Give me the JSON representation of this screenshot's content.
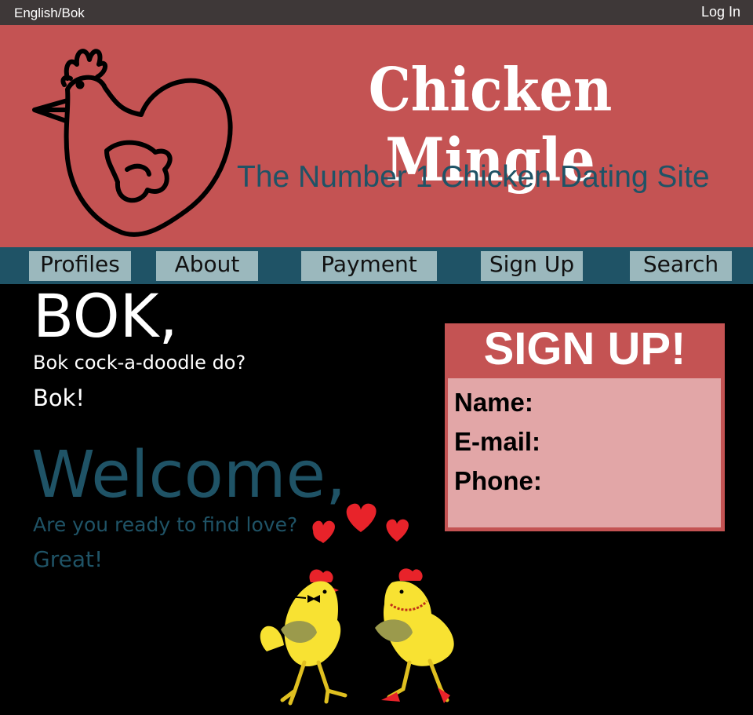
{
  "topbar": {
    "language": "English/Bok",
    "login": "Log In"
  },
  "header": {
    "title": "Chicken Mingle",
    "tagline": "The Number 1 Chicken Dating Site",
    "logo_icon": "chicken-heart-logo-icon"
  },
  "nav": {
    "items": [
      {
        "label": "Profiles"
      },
      {
        "label": "About"
      },
      {
        "label": "Payment"
      },
      {
        "label": "Sign Up"
      },
      {
        "label": "Search"
      }
    ]
  },
  "intro": {
    "heading": "BOK,",
    "line1": "Bok cock-a-doodle do?",
    "line2": "Bok!"
  },
  "welcome": {
    "heading": "Welcome,",
    "question": "Are you ready to find love?",
    "answer": "Great!"
  },
  "signup": {
    "title": "SIGN UP!",
    "fields": [
      {
        "label": "Name:"
      },
      {
        "label": "E-mail:"
      },
      {
        "label": "Phone:"
      }
    ]
  },
  "colors": {
    "header_red": "#c45353",
    "nav_teal": "#1f5366",
    "nav_button": "#9bb8bd",
    "form_pink": "#e2a6a7",
    "topbar": "#3e3838"
  }
}
